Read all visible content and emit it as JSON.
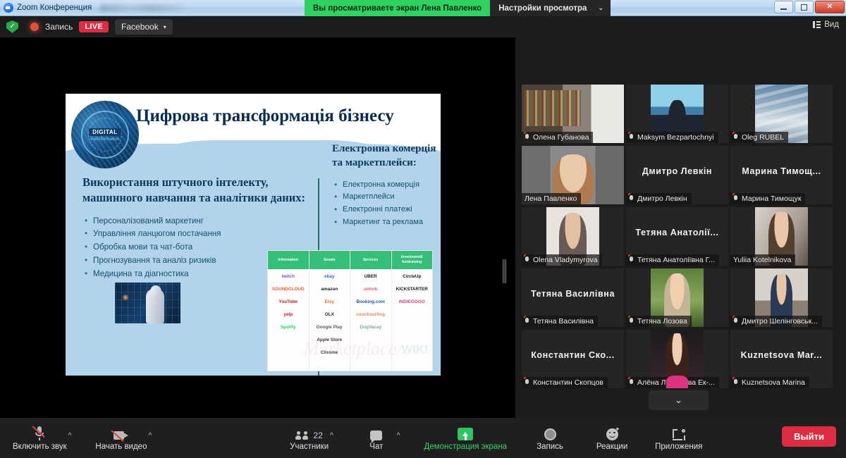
{
  "window": {
    "title": "Zoom Конференция",
    "logo_icon": "zoom-logo-icon",
    "minimize_label": "",
    "maximize_label": "",
    "close_label": "✕"
  },
  "share_banner": {
    "message": "Вы просматриваете экран Лена Павленко",
    "settings_label": "Настройки просмотра",
    "caret": "⌄"
  },
  "rec_bar": {
    "shield_icon": "security-shield-icon",
    "shield_glyph": "✓",
    "record_dot_icon": "recording-dot-icon",
    "record_label": "Запись",
    "live_label": "LIVE",
    "facebook_label": "Facebook",
    "facebook_caret": "▾",
    "view_label": "Вид",
    "view_icon": "view-layout-icon"
  },
  "slide": {
    "logo_line1": "DIGITAL",
    "logo_line2": "transformation",
    "title": "Цифрова трансформація бізнесу",
    "left_heading": "Використання штучного інтелекту, машинного навчання та аналітики даних:",
    "left_bullets": [
      "Персоналізований маркетинг",
      "Управління ланцюгом постачання",
      "Обробка мови та чат-бота",
      "Прогнозування та аналіз ризиків",
      "Медицина та діагностика"
    ],
    "right_heading": "Електронна комерція та маркетплейси:",
    "right_bullets": [
      "Електронна комерція",
      "Маркетплейси",
      "Електронні платежі",
      "Маркетинг та реклама"
    ],
    "robot_image_alt": "ai-robot-illustration",
    "marketplace_table": {
      "columns": [
        {
          "header": "Information",
          "items": [
            "twitch",
            "SOUNDCLOUD",
            "YouTube",
            "yelp",
            "Spotify"
          ],
          "colors": [
            "#8c50c8",
            "#f2603c",
            "#cc1f1f",
            "#c4202a",
            "#1ecd5f"
          ]
        },
        {
          "header": "Goods",
          "items": [
            "ebay",
            "amazon",
            "Etsy",
            "OLX",
            "Google Play",
            "Apple Store",
            "Chrome"
          ],
          "colors": [
            "#3266d6",
            "#1c1c1c",
            "#e8702a",
            "#2a2a2a",
            "#5a5a5a",
            "#3a3a3a",
            "#3a3a3a"
          ]
        },
        {
          "header": "Services",
          "items": [
            "UBER",
            "airbnb",
            "Booking.com",
            "couchsurfing",
            "DogVacay"
          ],
          "colors": [
            "#1c1c1c",
            "#f0607a",
            "#1b5bb0",
            "#e8875e",
            "#7aa8a0"
          ]
        },
        {
          "header": "Investment& fundraising",
          "items": [
            "CircleUp",
            "KICKSTARTER",
            "INDIEGOGO"
          ],
          "colors": [
            "#1c1c1c",
            "#1c1c1c",
            "#e0457f"
          ]
        }
      ],
      "watermark": "Marketplace",
      "watermark2": "WIKI"
    }
  },
  "participants": {
    "tiles": [
      {
        "name": "Олена Губанова",
        "big_name": "",
        "has_video": true,
        "muted": true,
        "active": false,
        "photo": "ph-books"
      },
      {
        "name": "Maksym Bezpartochnyi",
        "big_name": "",
        "has_video": true,
        "muted": true,
        "active": false,
        "photo": "ph-man-sea"
      },
      {
        "name": "Oleg RUBEL",
        "big_name": "",
        "has_video": true,
        "muted": true,
        "active": false,
        "photo": "ph-clouds"
      },
      {
        "name": "Лена Павленко",
        "big_name": "",
        "has_video": true,
        "muted": false,
        "active": true,
        "photo": "ph-lena"
      },
      {
        "name": "Дмитро Левкін",
        "big_name": "Дмитро Левкін",
        "has_video": false,
        "muted": true,
        "active": false,
        "photo": ""
      },
      {
        "name": "Марина Тимощук",
        "big_name": "Марина  Тимощ...",
        "has_video": false,
        "muted": true,
        "active": false,
        "photo": ""
      },
      {
        "name": "Olena Vladymyrova",
        "big_name": "",
        "has_video": true,
        "muted": true,
        "active": false,
        "photo": "ph-olena"
      },
      {
        "name": "Тетяна Анатоліївна Г...",
        "big_name": "Тетяна  Анатолії...",
        "has_video": false,
        "muted": true,
        "active": false,
        "photo": ""
      },
      {
        "name": "Yuliia Kotelnikova",
        "big_name": "",
        "has_video": true,
        "muted": false,
        "active": false,
        "photo": "ph-yuliia"
      },
      {
        "name": "Тетяна Василівна",
        "big_name": "Тетяна Василівна",
        "has_video": false,
        "muted": true,
        "active": false,
        "photo": ""
      },
      {
        "name": "Тетяна Лозова",
        "big_name": "",
        "has_video": true,
        "muted": true,
        "active": false,
        "photo": "ph-lozova"
      },
      {
        "name": "Дмитро Шелінговськ...",
        "big_name": "",
        "has_video": true,
        "muted": true,
        "active": false,
        "photo": "ph-dmytro"
      },
      {
        "name": "Константин Скопцов",
        "big_name": "Константин  Ско...",
        "has_video": false,
        "muted": true,
        "active": false,
        "photo": ""
      },
      {
        "name": "Алёна Луферова Ек-...",
        "big_name": "",
        "has_video": true,
        "muted": true,
        "active": false,
        "photo": "ph-alena"
      },
      {
        "name": "Kuznetsova Marina",
        "big_name": "Kuznetsova  Mar...",
        "has_video": false,
        "muted": true,
        "active": false,
        "photo": ""
      }
    ],
    "more_caret": "⌄"
  },
  "toolbar": {
    "audio_label": "Включить звук",
    "audio_icon": "microphone-muted-icon",
    "video_label": "Начать видео",
    "video_icon": "camera-off-icon",
    "participants_label": "Участники",
    "participants_count": "22",
    "participants_icon": "people-icon",
    "chat_label": "Чат",
    "chat_icon": "chat-bubble-icon",
    "share_label": "Демонстрация экрана",
    "share_icon": "share-screen-icon",
    "record_label": "Запись",
    "record_icon": "record-circle-icon",
    "reactions_label": "Реакции",
    "reactions_icon": "reactions-smiley-icon",
    "apps_label": "Приложения",
    "apps_icon": "apps-icon",
    "leave_label": "Выйти",
    "caret": "^"
  },
  "colors": {
    "accent_green": "#2fd160",
    "live_red": "#e02c42",
    "leave_red": "#e02c42",
    "active_speaker": "#e6e84a",
    "slide_blue": "#b2d3ec"
  }
}
